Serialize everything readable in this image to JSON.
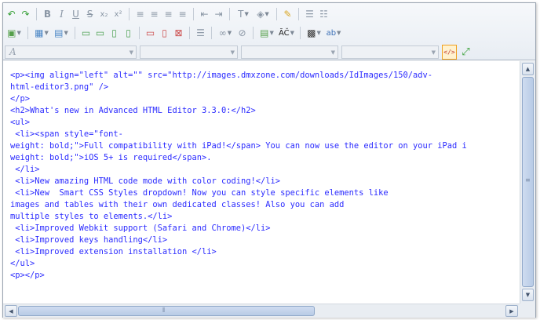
{
  "toolbar": {
    "row1": [
      {
        "name": "undo-button",
        "icon": "undo-icon",
        "glyph": "↶",
        "color": "#3aa13a"
      },
      {
        "name": "redo-button",
        "icon": "redo-icon",
        "glyph": "↷",
        "color": "#3aa13a"
      },
      {
        "sep": true
      },
      {
        "name": "bold-button",
        "icon": "bold-icon",
        "glyph": "B",
        "bold": true
      },
      {
        "name": "italic-button",
        "icon": "italic-icon",
        "glyph": "I",
        "italic": true
      },
      {
        "name": "underline-button",
        "icon": "underline-icon",
        "glyph": "U",
        "underline": true
      },
      {
        "name": "strikethrough-button",
        "icon": "strikethrough-icon",
        "glyph": "S",
        "strike": true
      },
      {
        "name": "subscript-button",
        "icon": "subscript-icon",
        "glyph": "x₂"
      },
      {
        "name": "superscript-button",
        "icon": "superscript-icon",
        "glyph": "x²"
      },
      {
        "sep": true
      },
      {
        "name": "align-left-button",
        "icon": "align-left-icon",
        "glyph": "≡"
      },
      {
        "name": "align-center-button",
        "icon": "align-center-icon",
        "glyph": "≡"
      },
      {
        "name": "align-right-button",
        "icon": "align-right-icon",
        "glyph": "≡"
      },
      {
        "name": "align-justify-button",
        "icon": "align-justify-icon",
        "glyph": "≡"
      },
      {
        "sep": true
      },
      {
        "name": "outdent-button",
        "icon": "outdent-icon",
        "glyph": "⇤"
      },
      {
        "name": "indent-button",
        "icon": "indent-icon",
        "glyph": "⇥"
      },
      {
        "sep": true
      },
      {
        "name": "font-color-button",
        "icon": "font-color-icon",
        "glyph": "T",
        "dropdown": true
      },
      {
        "name": "highlight-color-button",
        "icon": "paint-bucket-icon",
        "glyph": "◈",
        "dropdown": true
      },
      {
        "sep": true
      },
      {
        "name": "clean-formatting-button",
        "icon": "broom-icon",
        "glyph": "✎",
        "color": "#d9a520"
      },
      {
        "sep": true
      },
      {
        "name": "bulleted-list-button",
        "icon": "bulleted-list-icon",
        "glyph": "☰"
      },
      {
        "name": "numbered-list-button",
        "icon": "numbered-list-icon",
        "glyph": "☷"
      }
    ],
    "row2": [
      {
        "name": "insert-image-button",
        "icon": "image-icon",
        "glyph": "▣",
        "dropdown": true,
        "color": "#55a04a"
      },
      {
        "sep": true
      },
      {
        "name": "insert-table-button",
        "icon": "table-icon",
        "glyph": "▦",
        "dropdown": true,
        "color": "#4a86c5"
      },
      {
        "name": "table-properties-button",
        "icon": "table-properties-icon",
        "glyph": "▤",
        "dropdown": true,
        "color": "#4a86c5"
      },
      {
        "sep": true
      },
      {
        "name": "insert-row-above-button",
        "icon": "row-above-icon",
        "glyph": "▭",
        "color": "#4aa050"
      },
      {
        "name": "insert-row-below-button",
        "icon": "row-below-icon",
        "glyph": "▭",
        "color": "#4aa050"
      },
      {
        "name": "insert-column-left-button",
        "icon": "column-left-icon",
        "glyph": "▯",
        "color": "#4aa050"
      },
      {
        "name": "insert-column-right-button",
        "icon": "column-right-icon",
        "glyph": "▯",
        "color": "#4aa050"
      },
      {
        "sep": true
      },
      {
        "name": "delete-row-button",
        "icon": "delete-row-icon",
        "glyph": "▭",
        "color": "#cc4b4b"
      },
      {
        "name": "delete-column-button",
        "icon": "delete-column-icon",
        "glyph": "▯",
        "color": "#cc4b4b"
      },
      {
        "name": "delete-table-button",
        "icon": "delete-table-icon",
        "glyph": "⊠",
        "color": "#cc4b4b"
      },
      {
        "sep": true
      },
      {
        "name": "horizontal-rule-button",
        "icon": "horizontal-rule-icon",
        "glyph": "☰"
      },
      {
        "sep": true
      },
      {
        "name": "insert-link-button",
        "icon": "link-icon",
        "glyph": "∞",
        "dropdown": true
      },
      {
        "name": "remove-link-button",
        "icon": "unlink-icon",
        "glyph": "⊘"
      },
      {
        "sep": true
      },
      {
        "name": "insert-media-button",
        "icon": "media-icon",
        "glyph": "▤",
        "dropdown": true,
        "color": "#55a04a"
      },
      {
        "name": "special-characters-button",
        "icon": "special-characters-icon",
        "glyph": "ĀČ",
        "dropdown": true,
        "color": "#222222"
      },
      {
        "sep": true
      },
      {
        "name": "insert-widget-button",
        "icon": "widget-icon",
        "glyph": "▩",
        "dropdown": true,
        "color": "#333333"
      },
      {
        "name": "spell-check-button",
        "icon": "spell-check-icon",
        "glyph": "ab",
        "dropdown": true,
        "color": "#3b6fb6"
      }
    ],
    "row3": {
      "style_select": {
        "icon": "style-a-icon",
        "glyph": "A"
      },
      "code_view_button": {
        "icon": "code-view-icon",
        "glyph": "</>"
      },
      "fullscreen_button": {
        "icon": "fullscreen-icon",
        "glyph": "⤢"
      }
    }
  },
  "code_lines": [
    "<p><img align=\"left\" alt=\"\" src=\"http://images.dmxzone.com/downloads/IdImages/150/adv-",
    "html-editor3.png\" />",
    "</p>",
    "<h2>What's new in Advanced HTML Editor 3.3.0:</h2>",
    "<ul>",
    " <li><span style=\"font-",
    "weight: bold;\">Full compatibility with iPad!</span> You can now use the editor on your iPad i",
    "weight: bold;\">iOS 5+ is required</span>.",
    " </li>",
    " <li>New amazing HTML code mode with color coding!</li>",
    " <li>New  Smart CSS Styles dropdown! Now you can style specific elements like",
    "images and tables with their own dedicated classes! Also you can add",
    "multiple styles to elements.</li>",
    " <li>Improved Webkit support (Safari and Chrome)</li>",
    " <li>Improved keys handling</li>",
    " <li>Improved extension installation </li>",
    "</ul>",
    "<p></p>"
  ],
  "scrollbar_icons": {
    "up": "arrow-up-icon",
    "down": "arrow-down-icon",
    "left": "arrow-left-icon",
    "right": "arrow-right-icon",
    "grip": "grip-icon"
  }
}
